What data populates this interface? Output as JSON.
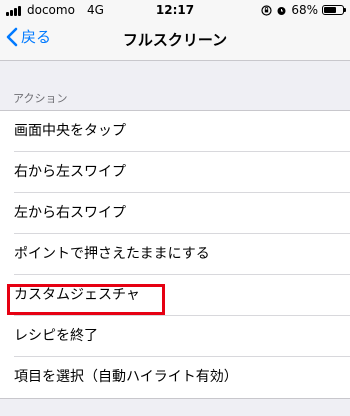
{
  "status_bar": {
    "carrier": "docomo",
    "network": "4G",
    "time": "12:17",
    "battery_percent": "68%",
    "battery_level": 0.68
  },
  "nav": {
    "back_label": "戻る",
    "title": "フルスクリーン"
  },
  "section": {
    "header": "アクション",
    "items": [
      {
        "label": "画面中央をタップ"
      },
      {
        "label": "右から左スワイプ"
      },
      {
        "label": "左から右スワイプ"
      },
      {
        "label": "ポイントで押さえたままにする"
      },
      {
        "label": "カスタムジェスチャ"
      },
      {
        "label": "レシピを終了"
      },
      {
        "label": "項目を選択（自動ハイライト有効）"
      }
    ]
  },
  "colors": {
    "accent": "#007aff",
    "highlight": "#e60012",
    "background": "#efeff4"
  }
}
